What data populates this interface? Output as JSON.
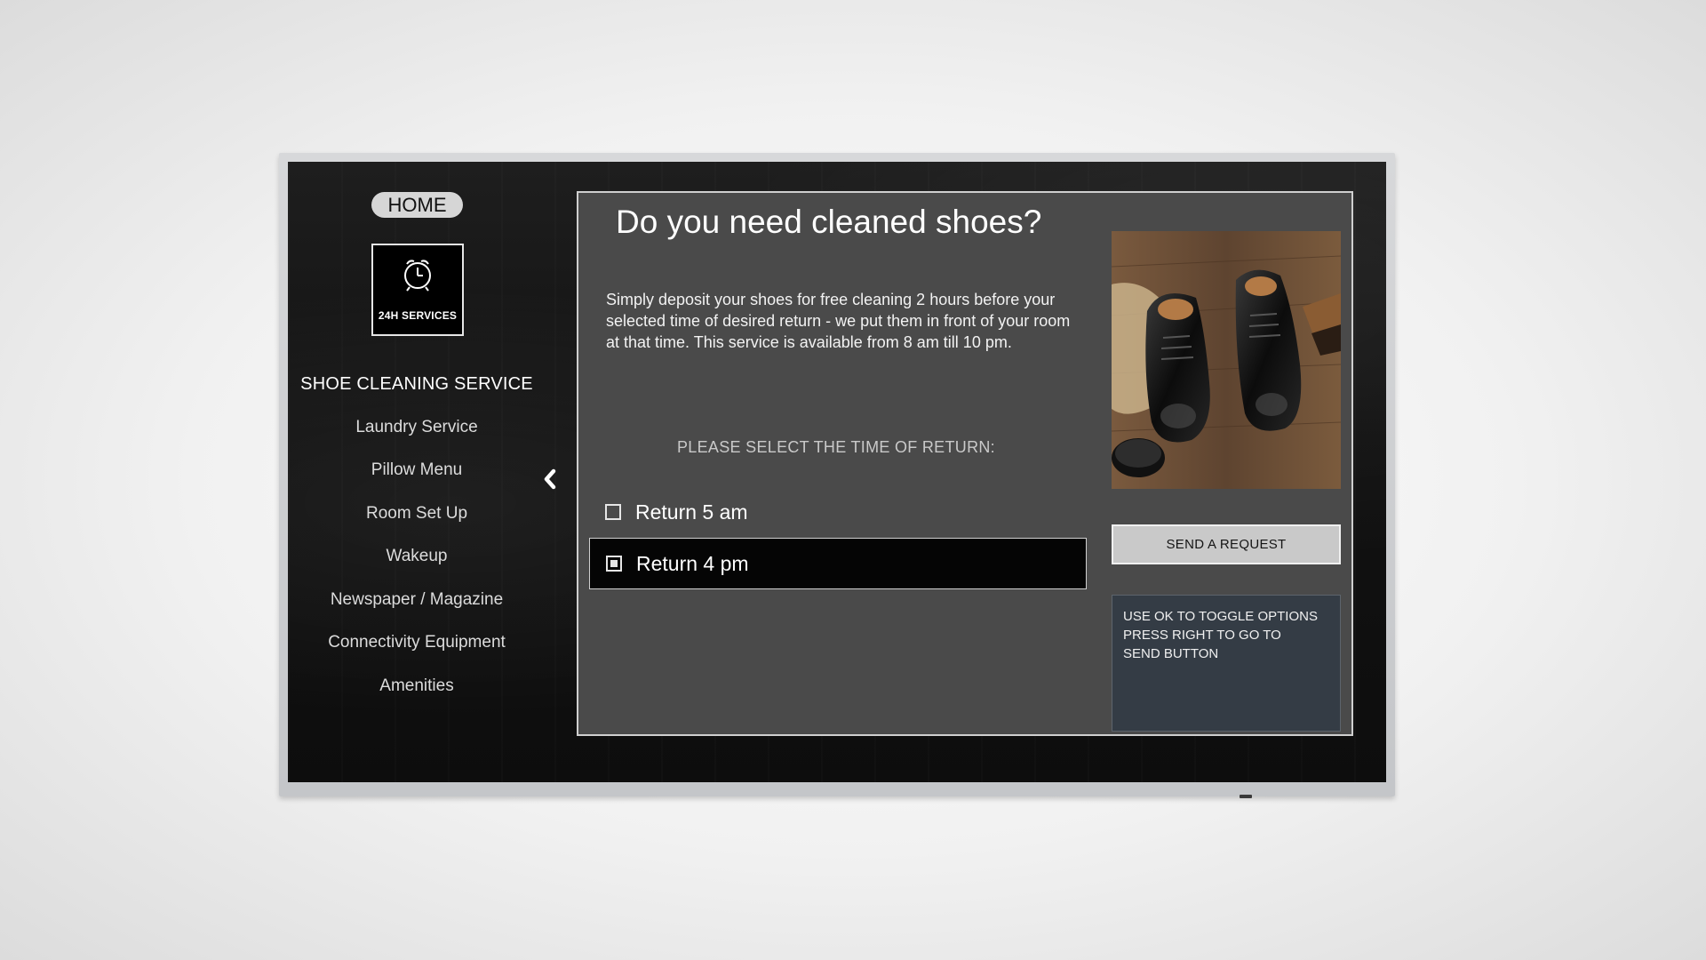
{
  "sidebar": {
    "home_label": "HOME",
    "tile_label": "24H SERVICES",
    "tile_icon": "alarm-clock-icon",
    "items": [
      {
        "label": "SHOE CLEANING SERVICE",
        "active": true
      },
      {
        "label": "Laundry Service"
      },
      {
        "label": "Pillow Menu"
      },
      {
        "label": "Room Set Up"
      },
      {
        "label": "Wakeup"
      },
      {
        "label": "Newspaper / Magazine"
      },
      {
        "label": "Connectivity Equipment"
      },
      {
        "label": "Amenities"
      }
    ],
    "back_icon": "chevron-left-icon"
  },
  "main": {
    "title": "Do you need cleaned shoes?",
    "description": "Simply deposit your shoes for free cleaning 2 hours before your selected time of desired return - we put them in front of your room at that time. This service is available from 8 am till 10 pm.",
    "select_prompt": "PLEASE SELECT THE TIME OF RETURN:",
    "options": [
      {
        "label": "Return 5 am",
        "checked": false
      },
      {
        "label": "Return 4 pm",
        "checked": true,
        "focused": true
      }
    ],
    "send_button": "SEND A REQUEST",
    "hint_lines": [
      "USE OK TO TOGGLE OPTIONS",
      "PRESS RIGHT TO GO TO",
      "SEND BUTTON"
    ]
  },
  "colors": {
    "panel_bg": "#4a4a4a",
    "hint_bg": "#343c45",
    "button_bg": "#c9c9c9"
  }
}
